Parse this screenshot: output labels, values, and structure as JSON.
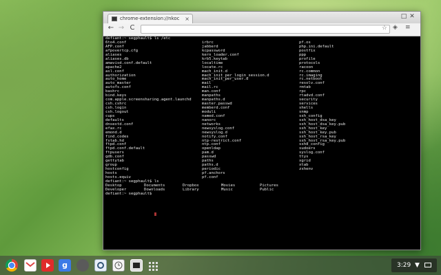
{
  "window": {
    "tab_title": "chrome-extension://nkoc",
    "tab_close": "×",
    "controls": [
      "□",
      "✕"
    ]
  },
  "toolbar": {
    "back": "←",
    "forward": "→",
    "reload": "C",
    "star": "☆"
  },
  "terminal": {
    "prompt1": "defiant:~ segphault$ ls /etc",
    "columns": [
      [
        "6to4.conf",
        "AFP.conf",
        "afpovertcp.cfg",
        "aliases",
        "aliases.db",
        "amavisd.conf.default",
        "apache2",
        "asl.conf",
        "authorization",
        "auto_home",
        "auto_master",
        "autofs.conf",
        "bashrc",
        "bind.keys",
        "com.apple.screensharing.agent.launchd",
        "csh.cshrc",
        "csh.login",
        "csh.logout",
        "cups",
        "defaults",
        "dnsextd.conf",
        "efax.rc",
        "emond.d",
        "find.codes",
        "fstab.hd",
        "ftpd.conf",
        "ftpd.conf.default",
        "ftpusers",
        "gdb.conf",
        "gettytab",
        "group",
        "hostconfig",
        "hosts",
        "hosts.equiv"
      ],
      [
        "irbrc",
        "jabberd",
        "kcpassword",
        "kern_loader.conf",
        "krb5.keytab",
        "localtime",
        "locate.rc",
        "mach_init.d",
        "mach_init_per_login_session.d",
        "mach_init_per_user.d",
        "mail",
        "mail.rc",
        "man.conf",
        "manpaths",
        "manpaths.d",
        "master.passwd",
        "memberd.conf",
        "moduli",
        "named.conf",
        "nanorc",
        "networks",
        "newsyslog.conf",
        "newsyslog.d",
        "notify.conf",
        "ntp-restrict.conf",
        "ntp.conf",
        "openldap",
        "pam.d",
        "passwd",
        "paths",
        "paths.d",
        "periodic",
        "pf.anchors",
        "pf.conf"
      ],
      [
        "pf.os",
        "php.ini.default",
        "postfix",
        "ppp",
        "profile",
        "protocols",
        "racoon",
        "rc.common",
        "rc.imaging",
        "rc.netboot",
        "resolv.conf",
        "rmtab",
        "rpc",
        "rtadvd.conf",
        "security",
        "services",
        "shells",
        "snmp",
        "ssh_config",
        "ssh_host_dsa_key",
        "ssh_host_dsa_key.pub",
        "ssh_host_key",
        "ssh_host_key.pub",
        "ssh_host_rsa_key",
        "ssh_host_rsa_key.pub",
        "sshd_config",
        "sudoers",
        "syslog.conf",
        "ttys",
        "xgrid",
        "xtab",
        "zshenv"
      ]
    ],
    "prompt2": "defiant:~ segphault$ ls",
    "ls_rows": [
      [
        "Desktop",
        "Documents",
        "Dropbox",
        "Movies",
        "Pictures"
      ],
      [
        "Developer",
        "Downloads",
        "Library",
        "Music",
        "Public"
      ]
    ],
    "prompt3": "defiant:~ segphault$"
  },
  "shelf": {
    "apps": [
      "chrome-icon",
      "gmail-icon",
      "youtube-icon",
      "google-search-icon",
      "evernote-icon",
      "settings-icon",
      "clock-icon",
      "terminal-icon",
      "apps-grid-icon"
    ],
    "time": "3:29"
  }
}
